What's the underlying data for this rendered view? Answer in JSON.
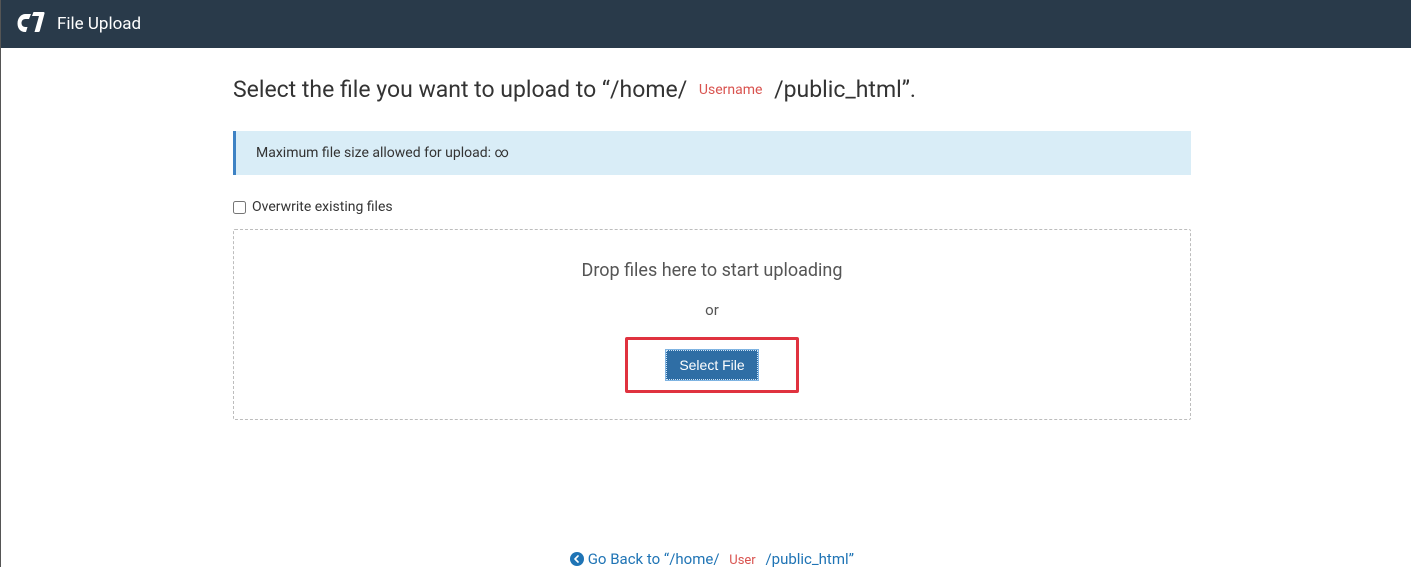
{
  "header": {
    "title": "File Upload"
  },
  "heading": {
    "prefix": "Select the file you want to upload to “/home/",
    "username_placeholder": "Username",
    "suffix": "/public_html”."
  },
  "notice": {
    "text": "Maximum file size allowed for upload: ∞"
  },
  "overwrite": {
    "label": "Overwrite existing files"
  },
  "dropzone": {
    "drop_text": "Drop files here to start uploading",
    "or_text": "or",
    "select_file_label": "Select File"
  },
  "goback": {
    "prefix": "Go Back to “/home/",
    "user_placeholder": "User",
    "suffix": "/public_html”"
  }
}
